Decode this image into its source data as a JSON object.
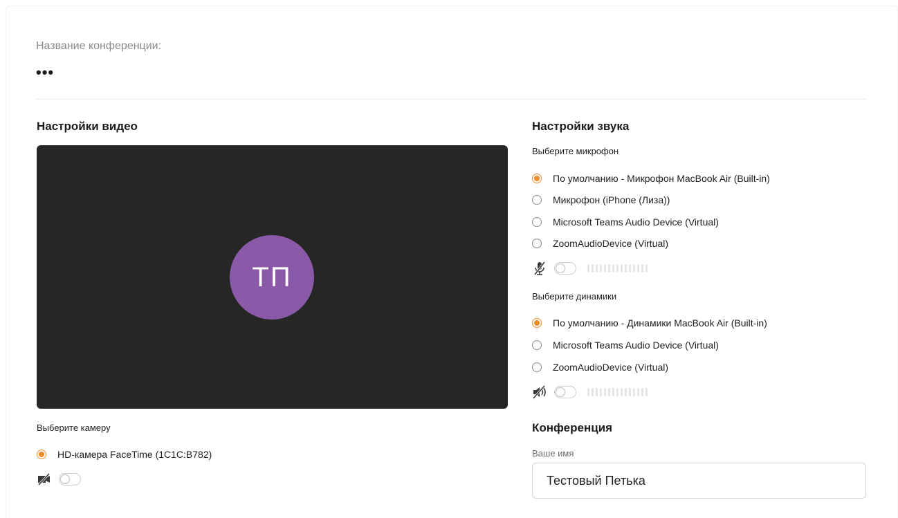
{
  "conference": {
    "label": "Название конференции:",
    "value": "•••"
  },
  "video": {
    "title": "Настройки видео",
    "avatar_initials": "ТП",
    "avatar_color": "#8a5aa9",
    "camera_label": "Выберите камеру",
    "cameras": [
      {
        "label": "HD-камера FaceTime (1C1C:B782)",
        "checked": true
      }
    ],
    "camera_toggle_on": false
  },
  "audio": {
    "title": "Настройки звука",
    "mic_label": "Выберите микрофон",
    "microphones": [
      {
        "label": "По умолчанию - Микрофон MacBook Air (Built-in)",
        "checked": true
      },
      {
        "label": "Микрофон (iPhone (Лиза))",
        "checked": false
      },
      {
        "label": "Microsoft Teams Audio Device (Virtual)",
        "checked": false
      },
      {
        "label": "ZoomAudioDevice (Virtual)",
        "checked": false
      }
    ],
    "mic_toggle_on": false,
    "speaker_label": "Выберите динамики",
    "speakers": [
      {
        "label": "По умолчанию - Динамики MacBook Air (Built-in)",
        "checked": true
      },
      {
        "label": "Microsoft Teams Audio Device (Virtual)",
        "checked": false
      },
      {
        "label": "ZoomAudioDevice (Virtual)",
        "checked": false
      }
    ],
    "speaker_toggle_on": false
  },
  "meeting": {
    "title": "Конференция",
    "name_label": "Ваше имя",
    "name_value": "Тестовый Петька"
  },
  "colors": {
    "accent": "#f28c28",
    "video_bg": "#262626"
  }
}
